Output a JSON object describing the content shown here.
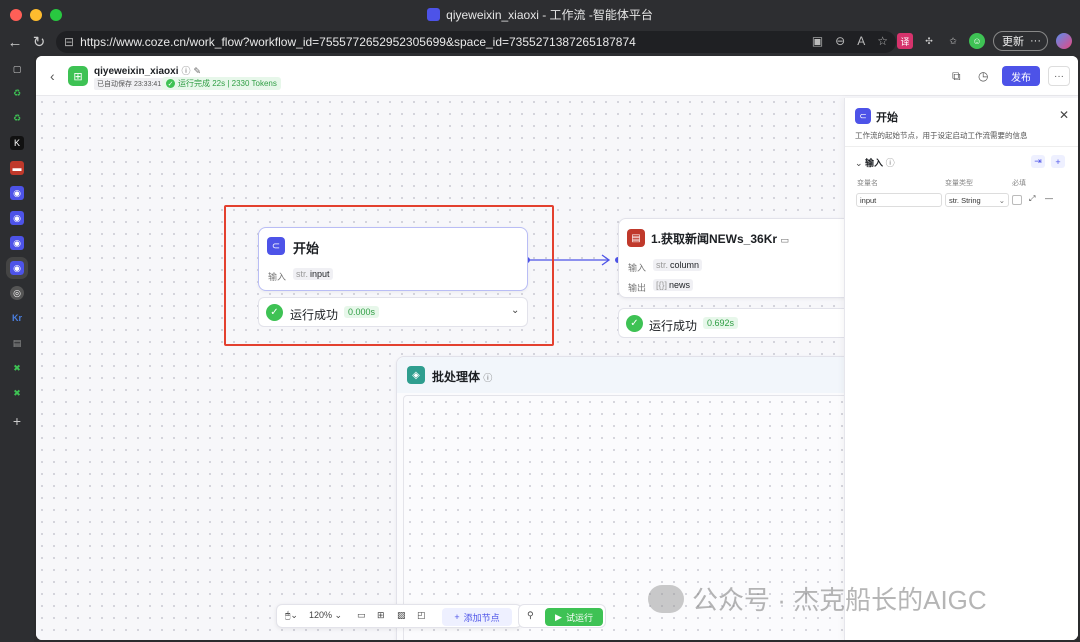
{
  "window": {
    "title": "qiyeweixin_xiaoxi - 工作流 -智能体平台"
  },
  "browser": {
    "url": "https://www.coze.cn/work_flow?workflow_id=7555772652952305699&space_id=7355271387265187874",
    "update_label": "更新"
  },
  "header": {
    "app_name": "qiyeweixin_xiaoxi",
    "autosave": "已自动保存 23:33:41",
    "run_status": "运行完成 22s | 2330 Tokens",
    "publish_label": "发布"
  },
  "start_node": {
    "title": "开始",
    "input_label": "输入",
    "input_type": "str.",
    "input_name": "input",
    "result_text": "运行成功",
    "result_time": "0.000s"
  },
  "news_node": {
    "title": "1.获取新闻NEWs_36Kr",
    "input_label": "输入",
    "input_type": "str.",
    "input_name": "column",
    "output_label": "输出",
    "output_type": "[{}]",
    "output_name": "news",
    "result_text": "运行成功",
    "result_time": "0.692s"
  },
  "batch_node": {
    "title": "批处理体"
  },
  "panel": {
    "title": "开始",
    "description": "工作流的起始节点，用于设定启动工作流需要的信息",
    "section_title": "输入",
    "col_var_name": "变量名",
    "col_var_type": "变量类型",
    "col_required": "必填",
    "var_name": "input",
    "var_type": "str. String"
  },
  "bottom_toolbar": {
    "zoom": "120%",
    "add_node": "添加节点",
    "test_run": "试运行"
  },
  "watermark": {
    "text": "公众号 · 杰克船长的AIGC"
  },
  "colors": {
    "accent": "#4d53e8",
    "success": "#3ec254",
    "highlight": "#e3402f"
  }
}
